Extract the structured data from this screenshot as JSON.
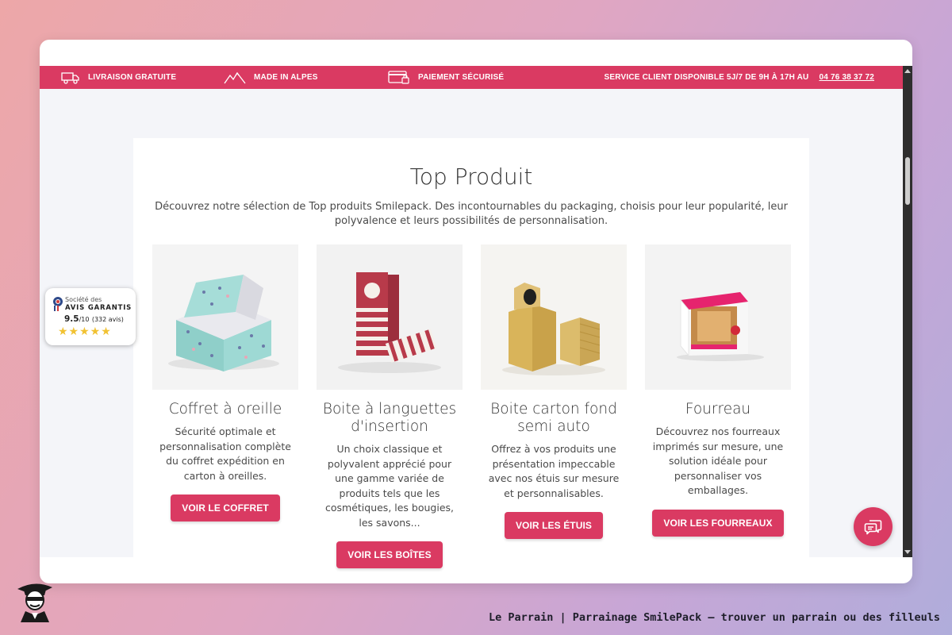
{
  "topbar": {
    "free_delivery": "LIVRAISON GRATUITE",
    "made_in": "MADE IN ALPES",
    "secure_payment": "PAIEMENT SÉCURISÉ",
    "service_text": "SERVICE CLIENT DISPONIBLE 5J/7 DE 9H À 17H AU",
    "service_phone": "04 76 38 37 72"
  },
  "section": {
    "title": "Top Produit",
    "description": "Découvrez notre sélection de Top produits Smilepack. Des incontournables du packaging, choisis pour leur popularité, leur polyvalence et leurs possibilités de personnalisation."
  },
  "products": [
    {
      "title": "Coffret à oreille",
      "text": "Sécurité optimale et personnalisation complète du coffret expédition en carton à oreilles.",
      "button": "VOIR LE COFFRET"
    },
    {
      "title": "Boite à languettes d'insertion",
      "text": "Un choix classique et polyvalent apprécié pour une gamme variée de produits tels que les cosmétiques, les bougies, les savons...",
      "button": "VOIR LES BOÎTES"
    },
    {
      "title": "Boite carton fond semi auto",
      "text": "Offrez à vos produits une présentation impeccable avec nos étuis sur mesure et personnalisables.",
      "button": "VOIR LES ÉTUIS"
    },
    {
      "title": "Fourreau",
      "text": "Découvrez nos fourreaux imprimés sur mesure, une solution idéale pour personnaliser vos emballages.",
      "button": "VOIR LES FOURREAUX"
    }
  ],
  "reviews_badge": {
    "line1": "Société des",
    "line2": "AVIS GARANTIS",
    "score": "9.5",
    "score_suffix": "/10",
    "count": "(332 avis)",
    "stars": "★★★★★"
  },
  "footer": {
    "caption": "Le Parrain | Parrainage SmilePack — trouver un parrain ou des filleuls"
  },
  "colors": {
    "accent": "#da3a62",
    "text": "#333333",
    "star": "#f1c232"
  },
  "icons": [
    "truck-icon",
    "mountain-icon",
    "card-icon",
    "chat-icon",
    "avatar-icon"
  ]
}
